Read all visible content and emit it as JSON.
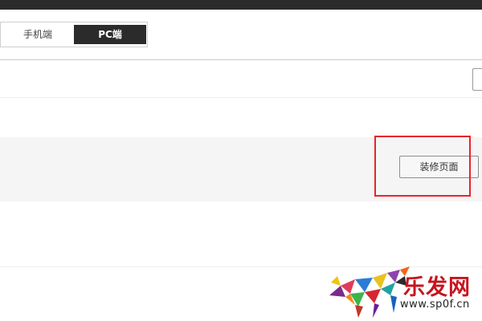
{
  "segmented": {
    "mobile_label": "手机端",
    "pc_label": "PC端",
    "selected": "PC端"
  },
  "actions": {
    "decorate_label": "装修页面"
  },
  "watermark": {
    "name": "乐发网",
    "url": "www.sp0f.cn"
  },
  "colors": {
    "topbar": "#2b2b2b",
    "segment_active_bg": "#2b2b2b",
    "band_bg": "#f5f5f5",
    "highlight": "#e8242a",
    "watermark_text": "#c8141e"
  },
  "icons": {
    "watermark_logo": "geometric-bull-logo"
  }
}
